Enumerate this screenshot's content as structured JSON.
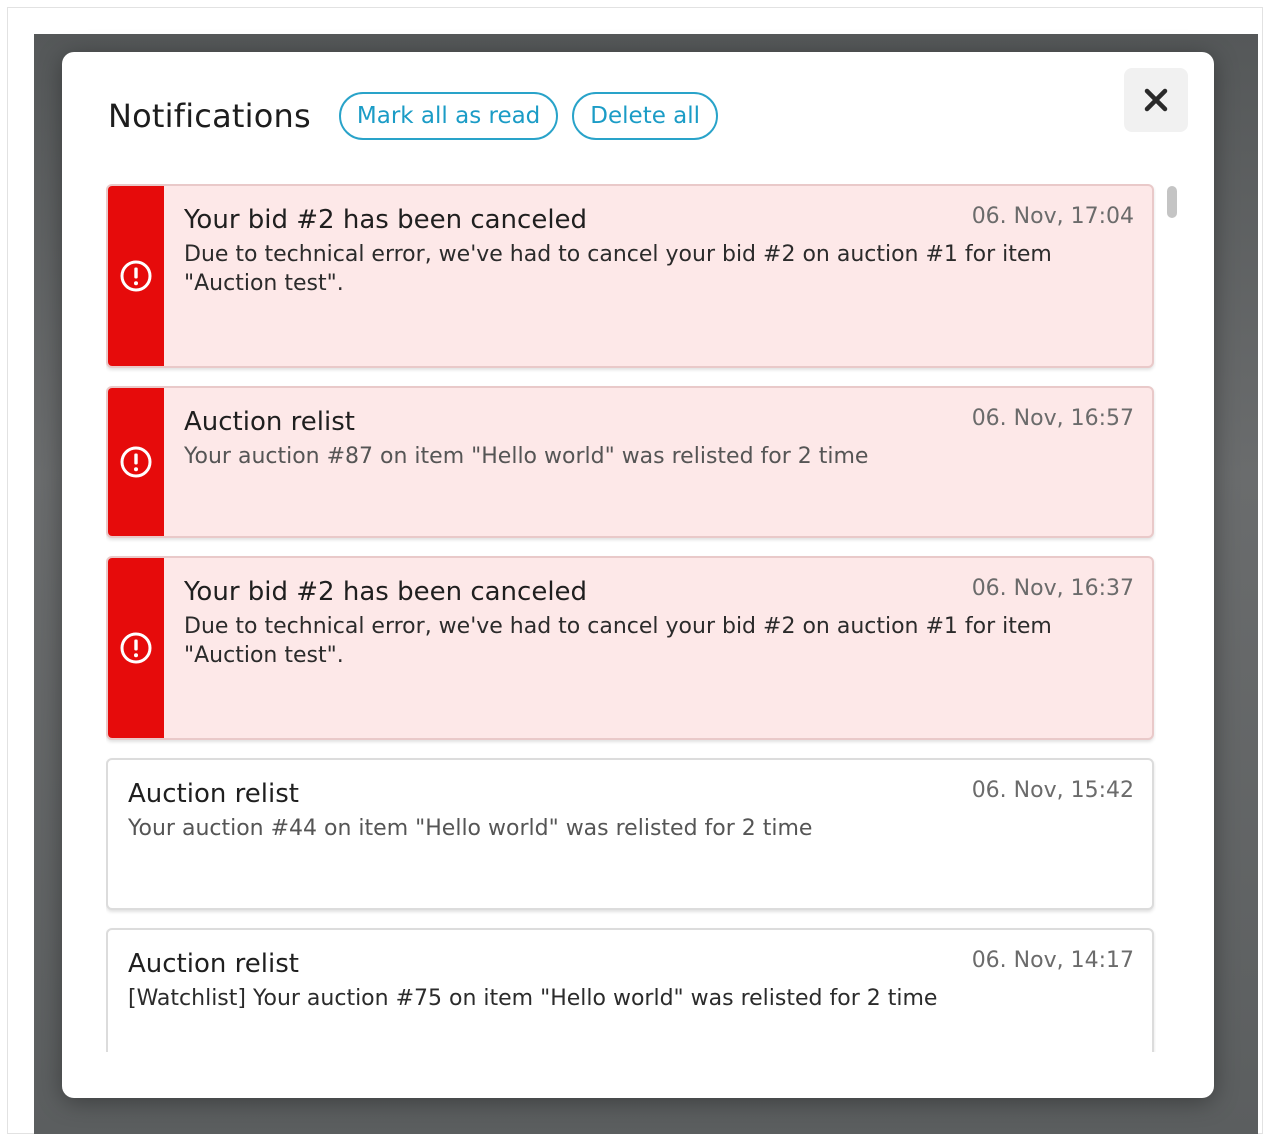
{
  "modal": {
    "title": "Notifications",
    "mark_all_read_label": "Mark all as read",
    "delete_all_label": "Delete all",
    "close_icon": "close-icon"
  },
  "notifications": [
    {
      "title": "Your bid #2 has been canceled",
      "time": "06. Nov, 17:04",
      "message": "Due to technical error, we've had to cancel your bid #2 on auction #1 for item \"Auction test\".",
      "unread": true,
      "icon": "alert-circle-icon"
    },
    {
      "title": "Auction relist",
      "time": "06. Nov, 16:57",
      "message": "Your auction #87 on item \"Hello world\" was relisted for 2 time",
      "unread": true,
      "icon": "alert-circle-icon"
    },
    {
      "title": "Your bid #2 has been canceled",
      "time": "06. Nov, 16:37",
      "message": "Due to technical error, we've had to cancel your bid #2 on auction #1 for item \"Auction test\".",
      "unread": true,
      "icon": "alert-circle-icon"
    },
    {
      "title": "Auction relist",
      "time": "06. Nov, 15:42",
      "message": "Your auction #44 on item \"Hello world\" was relisted for 2 time",
      "unread": false
    },
    {
      "title": "Auction relist",
      "time": "06. Nov, 14:17",
      "message": "[Watchlist] Your auction #75 on item \"Hello world\" was relisted for 2 time",
      "unread": false
    }
  ],
  "colors": {
    "accent": "#1b9cc6",
    "alert_stripe": "#e60b0b",
    "alert_bg": "#fde8e8"
  }
}
